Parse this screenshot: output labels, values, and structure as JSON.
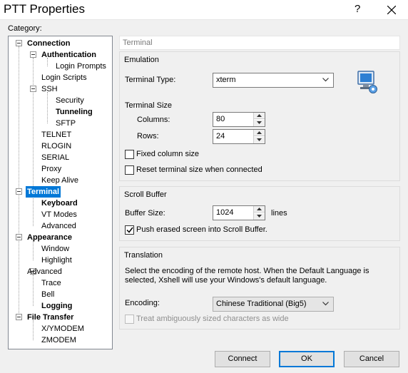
{
  "window": {
    "title": "PTT Properties",
    "help_glyph": "?"
  },
  "category_label": "Category:",
  "tree": [
    {
      "label": "Connection",
      "bold": true
    },
    {
      "label": "Authentication",
      "bold": true
    },
    {
      "label": "Login Prompts",
      "bold": false
    },
    {
      "label": "Login Scripts",
      "bold": false
    },
    {
      "label": "SSH",
      "bold": false
    },
    {
      "label": "Security",
      "bold": false
    },
    {
      "label": "Tunneling",
      "bold": true
    },
    {
      "label": "SFTP",
      "bold": false
    },
    {
      "label": "TELNET",
      "bold": false
    },
    {
      "label": "RLOGIN",
      "bold": false
    },
    {
      "label": "SERIAL",
      "bold": false
    },
    {
      "label": "Proxy",
      "bold": false
    },
    {
      "label": "Keep Alive",
      "bold": false
    },
    {
      "label": "Terminal",
      "bold": true,
      "selected": true
    },
    {
      "label": "Keyboard",
      "bold": true
    },
    {
      "label": "VT Modes",
      "bold": false
    },
    {
      "label": "Advanced",
      "bold": false
    },
    {
      "label": "Appearance",
      "bold": true
    },
    {
      "label": "Window",
      "bold": false
    },
    {
      "label": "Highlight",
      "bold": false
    },
    {
      "label": "Advanced",
      "bold": false
    },
    {
      "label": "Trace",
      "bold": false
    },
    {
      "label": "Bell",
      "bold": false
    },
    {
      "label": "Logging",
      "bold": true
    },
    {
      "label": "File Transfer",
      "bold": true
    },
    {
      "label": "X/YMODEM",
      "bold": false
    },
    {
      "label": "ZMODEM",
      "bold": false
    }
  ],
  "panel_header": "Terminal",
  "emulation": {
    "title": "Emulation",
    "terminal_type_label": "Terminal Type:",
    "terminal_type_value": "xterm",
    "terminal_size_label": "Terminal Size",
    "columns_label": "Columns:",
    "columns_value": "80",
    "rows_label": "Rows:",
    "rows_value": "24",
    "fixed_column_label": "Fixed column size",
    "fixed_column_checked": false,
    "reset_size_label": "Reset terminal size when connected",
    "reset_size_checked": false
  },
  "scroll_buffer": {
    "title": "Scroll Buffer",
    "size_label": "Buffer Size:",
    "size_value": "1024",
    "units": "lines",
    "push_label": "Push erased screen into Scroll Buffer.",
    "push_checked": true
  },
  "translation": {
    "title": "Translation",
    "description_line1": "Select the encoding of the remote host. When the Default Language is",
    "description_line2": "selected, Xshell will use your Windows's default language.",
    "encoding_label": "Encoding:",
    "encoding_value": "Chinese Traditional (Big5)",
    "ambiguous_label": "Treat ambiguously sized characters as wide",
    "ambiguous_checked": false
  },
  "buttons": {
    "connect": "Connect",
    "ok": "OK",
    "cancel": "Cancel"
  },
  "colors": {
    "selection": "#0078d7",
    "default_button_border": "#0078d7"
  }
}
